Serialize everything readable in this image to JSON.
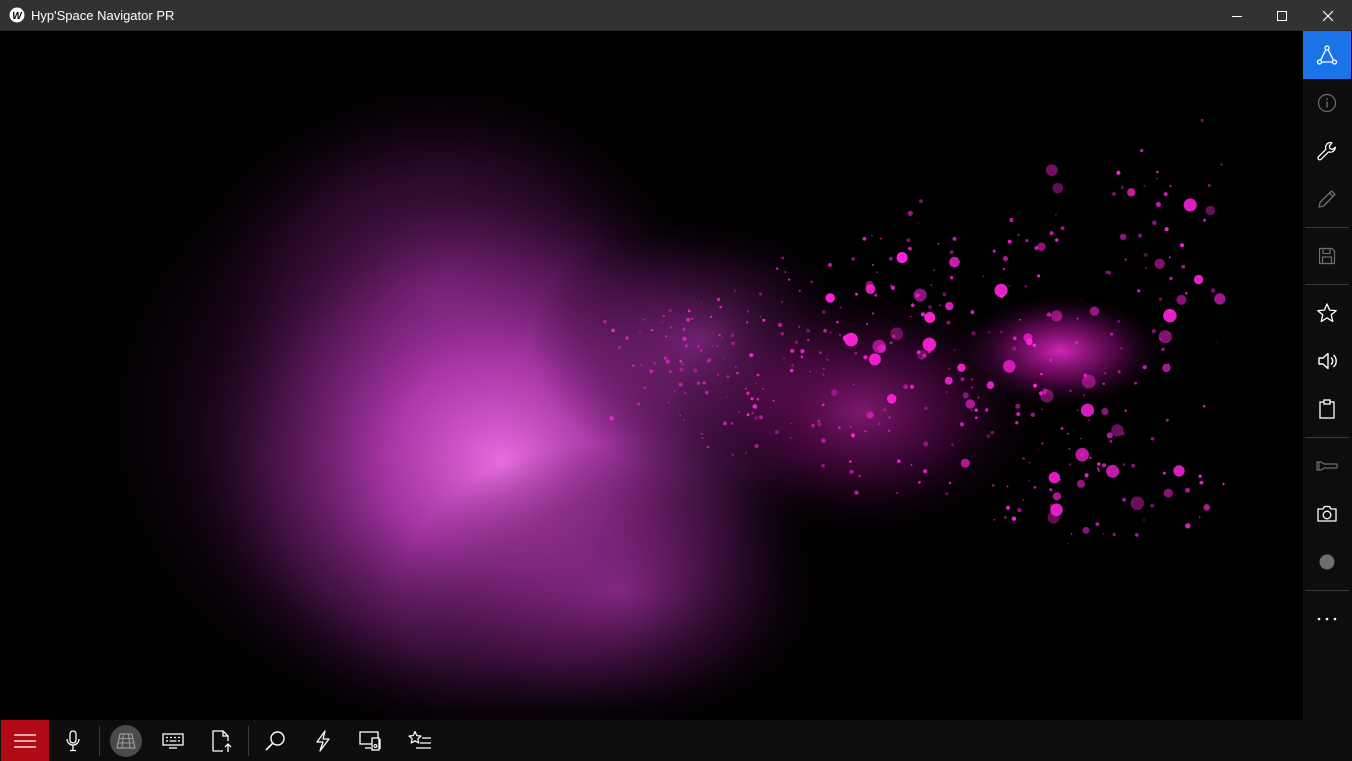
{
  "window": {
    "title": "Hyp'Space Navigator PR",
    "app_icon_letter": "W",
    "controls": [
      "minimize-icon",
      "maximize-icon",
      "close-icon"
    ]
  },
  "canvas": {
    "content": "magenta-powder-explosion-on-black",
    "colors": {
      "background": "#000000",
      "cloud": "#e060e0",
      "particles": "#ff22dd"
    }
  },
  "right_toolbar": {
    "active_color": "#1a73e8",
    "items": [
      {
        "icon": "network-icon",
        "active": true
      },
      {
        "icon": "info-icon",
        "enabled": false
      },
      {
        "icon": "wrench-icon",
        "enabled": true
      },
      {
        "icon": "pencil-icon",
        "enabled": false
      },
      {
        "icon": "save-icon",
        "enabled": false
      },
      {
        "icon": "star-icon",
        "enabled": true
      },
      {
        "icon": "volume-icon",
        "enabled": true
      },
      {
        "icon": "clipboard-icon",
        "enabled": true
      },
      {
        "icon": "flashlight-icon",
        "enabled": false
      },
      {
        "icon": "camera-icon",
        "enabled": true
      },
      {
        "icon": "record-icon",
        "enabled": false
      },
      {
        "icon": "more-icon",
        "enabled": true
      }
    ]
  },
  "bottom_toolbar": {
    "menu_color": "#b00a14",
    "items": [
      {
        "icon": "hamburger-menu-icon",
        "active": true
      },
      {
        "icon": "microphone-icon"
      },
      {
        "icon": "grid-icon",
        "selected": true
      },
      {
        "icon": "keyboard-icon"
      },
      {
        "icon": "file-export-icon"
      },
      {
        "icon": "search-icon"
      },
      {
        "icon": "lightning-icon"
      },
      {
        "icon": "media-devices-icon"
      },
      {
        "icon": "favorites-list-icon"
      }
    ]
  }
}
